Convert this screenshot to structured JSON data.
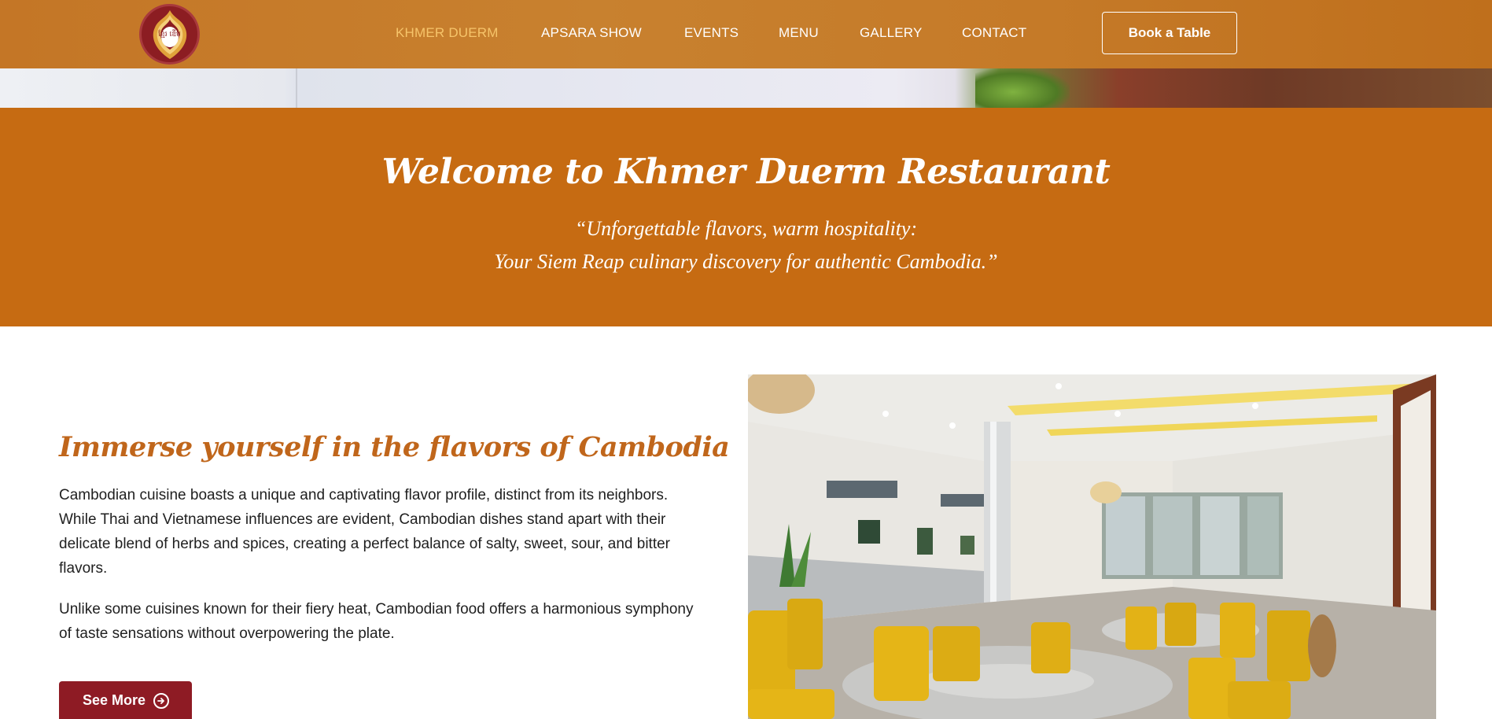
{
  "header": {
    "logo_text": "ខ្មែរ ឌើម",
    "nav": [
      {
        "label": "KHMER DUERM",
        "active": true
      },
      {
        "label": "APSARA SHOW",
        "active": false
      },
      {
        "label": "EVENTS",
        "active": false
      },
      {
        "label": "MENU",
        "active": false
      },
      {
        "label": "GALLERY",
        "active": false
      },
      {
        "label": "CONTACT",
        "active": false
      }
    ],
    "book_label": "Book a Table"
  },
  "welcome": {
    "title": "Welcome to Khmer Duerm Restaurant",
    "tagline_line1": "“Unforgettable flavors, warm hospitality:",
    "tagline_line2": "Your Siem Reap culinary discovery for authentic Cambodia.”"
  },
  "content": {
    "title": "Immerse yourself in the flavors of Cambodia",
    "paragraph1": "Cambodian cuisine boasts a unique and captivating flavor profile, distinct from its neighbors. While Thai and Vietnamese influences are evident, Cambodian dishes stand apart with their delicate blend of herbs and spices, creating a perfect balance of salty, sweet, sour, and bitter flavors.",
    "paragraph2": "Unlike some cuisines known for their fiery heat, Cambodian food offers a harmonious symphony of taste sensations without overpowering the plate.",
    "see_more_label": "See More"
  },
  "icons": {
    "see_more": "arrow-circle-right-icon",
    "logo": "temple-crest-icon"
  },
  "colors": {
    "header": "#c47626",
    "accent_orange": "#c66b12",
    "title_orange": "#c0661b",
    "active_nav": "#f6c46a",
    "button_maroon": "#8e1b24"
  }
}
